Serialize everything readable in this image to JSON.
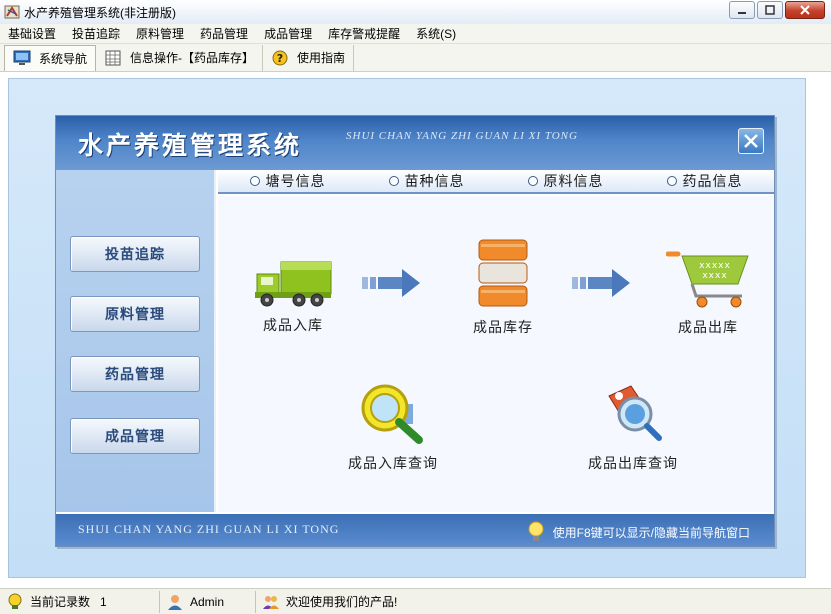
{
  "window": {
    "title": "水产养殖管理系统(非注册版)",
    "minimize_icon": "minimize-icon",
    "maximize_icon": "maximize-icon",
    "close_icon": "close-icon"
  },
  "menubar": {
    "items": [
      "基础设置",
      "投苗追踪",
      "原料管理",
      "药品管理",
      "成品管理",
      "库存警戒提醒",
      "系统(S)"
    ]
  },
  "toolbar": {
    "buttons": [
      {
        "label": "系统导航",
        "icon": "monitor-icon"
      },
      {
        "label": "信息操作-【药品库存】",
        "icon": "grid-icon"
      },
      {
        "label": "使用指南",
        "icon": "help-icon"
      }
    ]
  },
  "nav": {
    "title": "水产养殖管理系统",
    "subtitle": "SHUI CHAN YANG ZHI GUAN LI XI TONG",
    "side_buttons": [
      "投苗追踪",
      "原料管理",
      "药品管理",
      "成品管理"
    ],
    "radio_options": [
      "塘号信息",
      "苗种信息",
      "原料信息",
      "药品信息"
    ],
    "flow": {
      "inbound": "成品入库",
      "stock": "成品库存",
      "outbound": "成品出库",
      "inbound_query": "成品入库查询",
      "outbound_query": "成品出库查询"
    },
    "footer_left": "SHUI CHAN YANG ZHI GUAN LI XI TONG",
    "footer_hint": "使用F8键可以显示/隐藏当前导航窗口"
  },
  "statusbar": {
    "record_label": "当前记录数",
    "record_count": "1",
    "user": "Admin",
    "welcome": "欢迎使用我们的产品!"
  },
  "colors": {
    "header_blue": "#3a6fb5",
    "workspace_bg": "#cfe4f8",
    "truck_green": "#8fc21f",
    "cart_green": "#9fc93c",
    "barrel_orange": "#f08a2a"
  }
}
